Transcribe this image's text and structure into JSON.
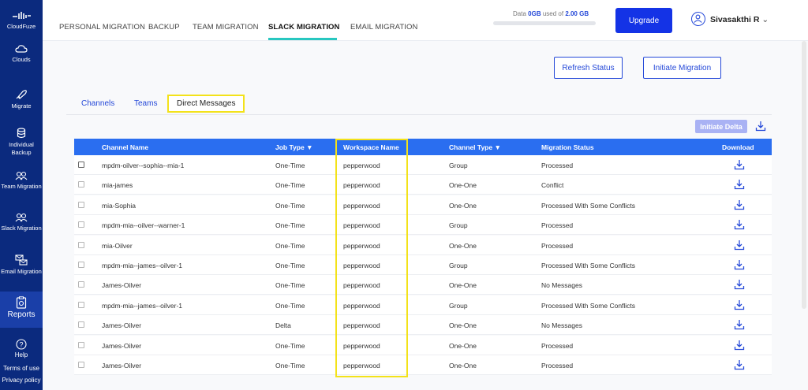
{
  "brand": {
    "name": "CloudFuze"
  },
  "sidebar": {
    "items": [
      {
        "label": "Clouds",
        "icon": "cloud-icon"
      },
      {
        "label": "Migrate",
        "icon": "rocket-icon"
      },
      {
        "label": "Individual Backup",
        "icon": "database-icon"
      },
      {
        "label": "Team Migration",
        "icon": "team-icon"
      },
      {
        "label": "Slack Migration",
        "icon": "users-icon"
      },
      {
        "label": "Email Migration",
        "icon": "email-icon"
      },
      {
        "label": "Reports",
        "icon": "report-icon"
      }
    ],
    "help": "Help",
    "terms": "Terms of use",
    "privacy": "Privacy policy"
  },
  "topnav": {
    "tabs": [
      "PERSONAL MIGRATION",
      "BACKUP",
      "TEAM MIGRATION",
      "SLACK MIGRATION",
      "EMAIL MIGRATION"
    ],
    "active_tab": "SLACK MIGRATION",
    "storage": {
      "prefix": "Data",
      "used": "0GB",
      "middle": "used of",
      "total": "2.00 GB"
    },
    "upgrade": "Upgrade",
    "user": "Sivasakthi R"
  },
  "actions": {
    "refresh": "Refresh Status",
    "initiate": "Initiate Migration",
    "initiate_delta": "Initiate Delta"
  },
  "subtabs": {
    "channels": "Channels",
    "teams": "Teams",
    "direct": "Direct Messages"
  },
  "table": {
    "headers": {
      "channel": "Channel Name",
      "job": "Job Type",
      "workspace": "Workspace Name",
      "ctype": "Channel Type",
      "status": "Migration Status",
      "download": "Download"
    },
    "rows": [
      {
        "channel": "mpdm-oilver--sophia--mia-1",
        "job": "One-Time",
        "workspace": "pepperwood",
        "ctype": "Group",
        "status": "Processed"
      },
      {
        "channel": "mia-james",
        "job": "One-Time",
        "workspace": "pepperwood",
        "ctype": "One-One",
        "status": "Conflict"
      },
      {
        "channel": "mia-Sophia",
        "job": "One-Time",
        "workspace": "pepperwood",
        "ctype": "One-One",
        "status": "Processed With Some Conflicts"
      },
      {
        "channel": "mpdm-mia--oilver--warner-1",
        "job": "One-Time",
        "workspace": "pepperwood",
        "ctype": "Group",
        "status": "Processed"
      },
      {
        "channel": "mia-Oilver",
        "job": "One-Time",
        "workspace": "pepperwood",
        "ctype": "One-One",
        "status": "Processed"
      },
      {
        "channel": "mpdm-mia--james--oilver-1",
        "job": "One-Time",
        "workspace": "pepperwood",
        "ctype": "Group",
        "status": "Processed With Some Conflicts"
      },
      {
        "channel": "James-Oilver",
        "job": "One-Time",
        "workspace": "pepperwood",
        "ctype": "One-One",
        "status": "No Messages"
      },
      {
        "channel": "mpdm-mia--james--oilver-1",
        "job": "One-Time",
        "workspace": "pepperwood",
        "ctype": "Group",
        "status": "Processed With Some Conflicts"
      },
      {
        "channel": "James-Oilver",
        "job": "Delta",
        "workspace": "pepperwood",
        "ctype": "One-One",
        "status": "No Messages"
      },
      {
        "channel": "James-Oilver",
        "job": "One-Time",
        "workspace": "pepperwood",
        "ctype": "One-One",
        "status": "Processed"
      },
      {
        "channel": "James-Oilver",
        "job": "One-Time",
        "workspace": "pepperwood",
        "ctype": "One-One",
        "status": "Processed"
      }
    ]
  },
  "colors": {
    "sidebar": "#0b2a7e",
    "accent": "#2448d8",
    "header": "#2a6ef0",
    "highlight": "#f3e21a",
    "tab_underline": "#28c7c0"
  }
}
